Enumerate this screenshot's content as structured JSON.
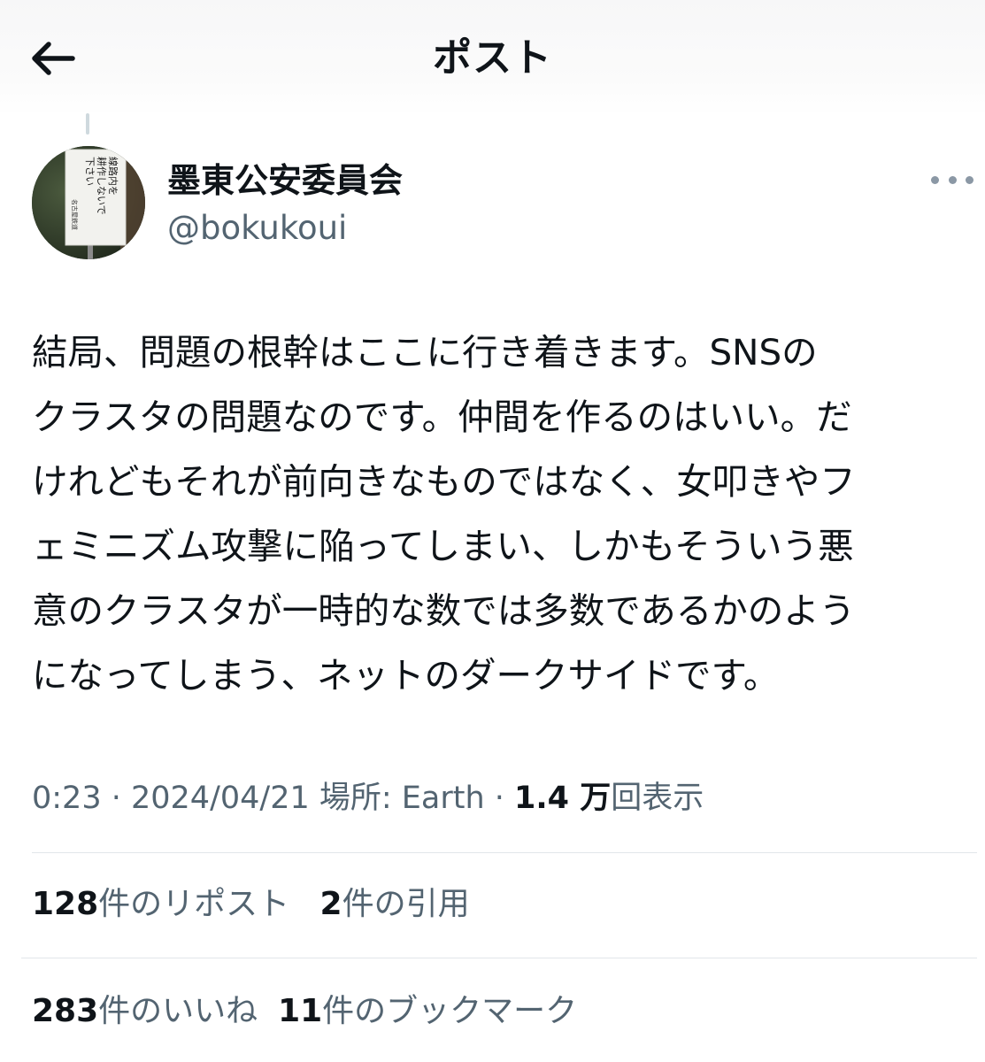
{
  "header": {
    "title": "ポスト",
    "back_icon": "arrow-left-icon"
  },
  "author": {
    "display_name": "墨東公安委員会",
    "handle": "@bokukoui",
    "avatar_sign_lines": [
      "線路内を",
      "耕作しないで",
      "下さい"
    ],
    "avatar_sign_footer": "名古屋鉄道",
    "more_icon": "more-dots-icon"
  },
  "tweet": {
    "lines": [
      "結局、問題の根幹はここに行き着きます。SNSの",
      "クラスタの問題なのです。仲間を作るのはいい。だ",
      "けれどもそれが前向きなものではなく、女叩きやフ",
      "ェミニズム攻撃に陥ってしまい、しかもそういう悪",
      "意のクラスタが一時的な数では多数であるかのよう",
      "になってしまう、ネットのダークサイドです。"
    ]
  },
  "meta": {
    "time": "0:23",
    "sep1": " · ",
    "date": "2024/04/21",
    "location_label": " 場所: ",
    "location": "Earth",
    "sep2": " · ",
    "views_count": "1.4 万",
    "views_label": "回表示"
  },
  "stats": {
    "reposts_count": "128",
    "reposts_label": "件のリポスト",
    "quotes_count": "2",
    "quotes_label": "件の引用",
    "likes_count": "283",
    "likes_label": "件のいいね",
    "bookmarks_count": "11",
    "bookmarks_label": "件のブックマーク"
  },
  "colors": {
    "text": "#0f1419",
    "secondary": "#536471",
    "divider": "#e1e6ea"
  }
}
